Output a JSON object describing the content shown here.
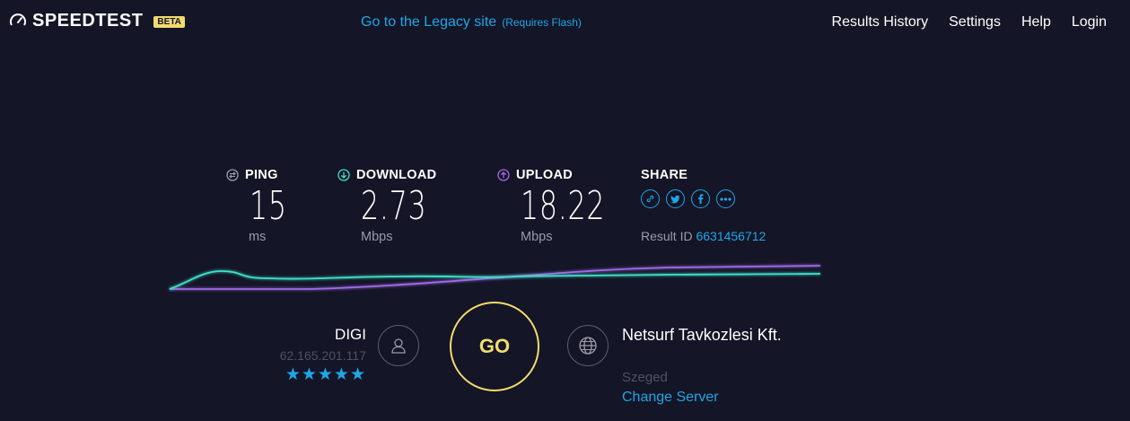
{
  "header": {
    "logo_text": "SPEEDTEST",
    "beta_badge": "BETA",
    "legacy_link": "Go to the Legacy site",
    "legacy_note": "(Requires Flash)",
    "nav": [
      "Results History",
      "Settings",
      "Help",
      "Login"
    ]
  },
  "metrics": {
    "ping": {
      "label": "PING",
      "value": "15",
      "unit": "ms"
    },
    "download": {
      "label": "DOWNLOAD",
      "value": "2.73",
      "unit": "Mbps"
    },
    "upload": {
      "label": "UPLOAD",
      "value": "18.22",
      "unit": "Mbps"
    }
  },
  "share": {
    "label": "SHARE",
    "icons": [
      "link-icon",
      "twitter-icon",
      "facebook-icon",
      "more-icon"
    ],
    "result_id_label": "Result ID",
    "result_id": "6631456712"
  },
  "isp": {
    "name": "DIGI",
    "ip": "62.165.201.117",
    "stars": "★★★★★"
  },
  "go": {
    "label": "GO"
  },
  "server": {
    "name": "Netsurf Tavkozlesi Kft.",
    "location": "Szeged",
    "change_label": "Change Server"
  },
  "colors": {
    "background": "#141526",
    "accent_blue": "#1fa6e8",
    "download_line": "#3ee0c8",
    "upload_line": "#a06ae8",
    "go_yellow": "#f2dc6e"
  }
}
